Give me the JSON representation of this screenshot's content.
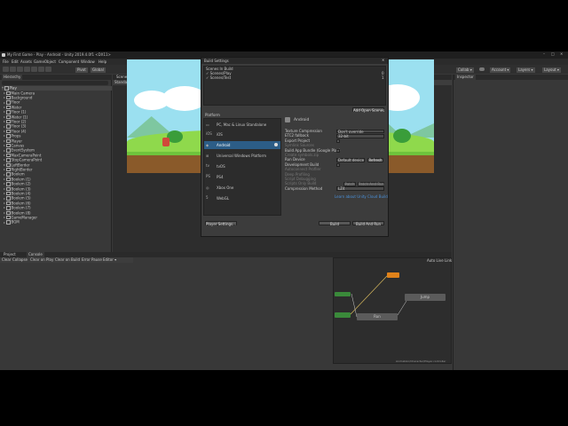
{
  "window": {
    "title": "My First Game - Play - Android - Unity 2019.4.0f1 <DX11>"
  },
  "menu": [
    "File",
    "Edit",
    "Assets",
    "GameObject",
    "Component",
    "Window",
    "Help"
  ],
  "toolbar": {
    "pivot": "Pivot",
    "global": "Global",
    "collab": "Collab ▾",
    "account": "Account ▾",
    "layers": "Layers ▾",
    "layout": "Layout ▾"
  },
  "hierarchy": {
    "tab": "Hierarchy",
    "scene": "Play",
    "items": [
      "Main Camera",
      "Background",
      "Floor",
      "Water",
      "Floor (1)",
      "Water (1)",
      "Floor (2)",
      "Floor (3)",
      "Floor (4)",
      "Props",
      "Player",
      "Canvas",
      "EventSystem",
      "MaxCameraPoint",
      "StopCameraPoint",
      "LeftBorder",
      "RightBorder",
      "Boolem",
      "Boolem (1)",
      "Boolem (2)",
      "Boolem (3)",
      "Boolem (4)",
      "Boolem (5)",
      "Boolem (6)",
      "Boolem (7)",
      "Boolem (8)",
      "GameManager",
      "BGM"
    ]
  },
  "center_tabs": [
    "Scene",
    "Game",
    "Asset Store"
  ],
  "game_view": {
    "display": "Standard",
    "maximize": "Maximize"
  },
  "inspector": {
    "tab": "Inspector"
  },
  "build_settings": {
    "title": "Build Settings",
    "scenes_header": "Scenes In Build",
    "scenes": [
      {
        "name": "Scenes/Play",
        "index": "0"
      },
      {
        "name": "Scenes/Test",
        "index": "1"
      }
    ],
    "add_open_scenes": "Add Open Scenes",
    "platform_header": "Platform",
    "platforms": [
      "PC, Mac & Linux Standalone",
      "iOS",
      "Android",
      "Universal Windows Platform",
      "tvOS",
      "PS4",
      "Xbox One",
      "WebGL"
    ],
    "selected_platform_title": "Android",
    "settings": [
      {
        "label": "Texture Compression",
        "value": "Don't override"
      },
      {
        "label": "ETC2 fallback",
        "value": "32-bit"
      },
      {
        "label": "Export Project",
        "value": ""
      },
      {
        "label": "Symlink Sources",
        "value": ""
      },
      {
        "label": "Build App Bundle (Google Play)",
        "value": ""
      },
      {
        "label": "Create symbols.zip",
        "value": ""
      },
      {
        "label": "Run Device",
        "value": "Default device"
      },
      {
        "label": "Development Build",
        "value": ""
      },
      {
        "label": "Autoconnect Profiler",
        "value": ""
      },
      {
        "label": "Deep Profiling",
        "value": ""
      },
      {
        "label": "Script Debugging",
        "value": ""
      },
      {
        "label": "Scripts Only Build",
        "value": ""
      },
      {
        "label": "Compression Method",
        "value": "LZ4"
      }
    ],
    "refresh": "Refresh",
    "patch": "Patch",
    "patch_and_run": "Patch And Run",
    "cloud_link": "Learn about Unity Cloud Build",
    "player_settings": "Player Settings...",
    "build": "Build",
    "build_and_run": "Build And Run"
  },
  "bottom_tabs": [
    "Project",
    "Console"
  ],
  "console_bar": [
    "Clear",
    "Collapse",
    "Clear on Play",
    "Clear on Build",
    "Error Pause",
    "Editor ▾"
  ],
  "animator": {
    "auto_live_link": "Auto Live Link",
    "path": "Animation/Character/Player.controller",
    "node_a": "Jump",
    "node_b": "Run"
  },
  "colors": {
    "accent": "#2c5d87",
    "panel": "#383838",
    "dark": "#2a2a2a",
    "link": "#4a90d9",
    "node_green": "#3a8a3a",
    "node_orange": "#e0821a"
  }
}
